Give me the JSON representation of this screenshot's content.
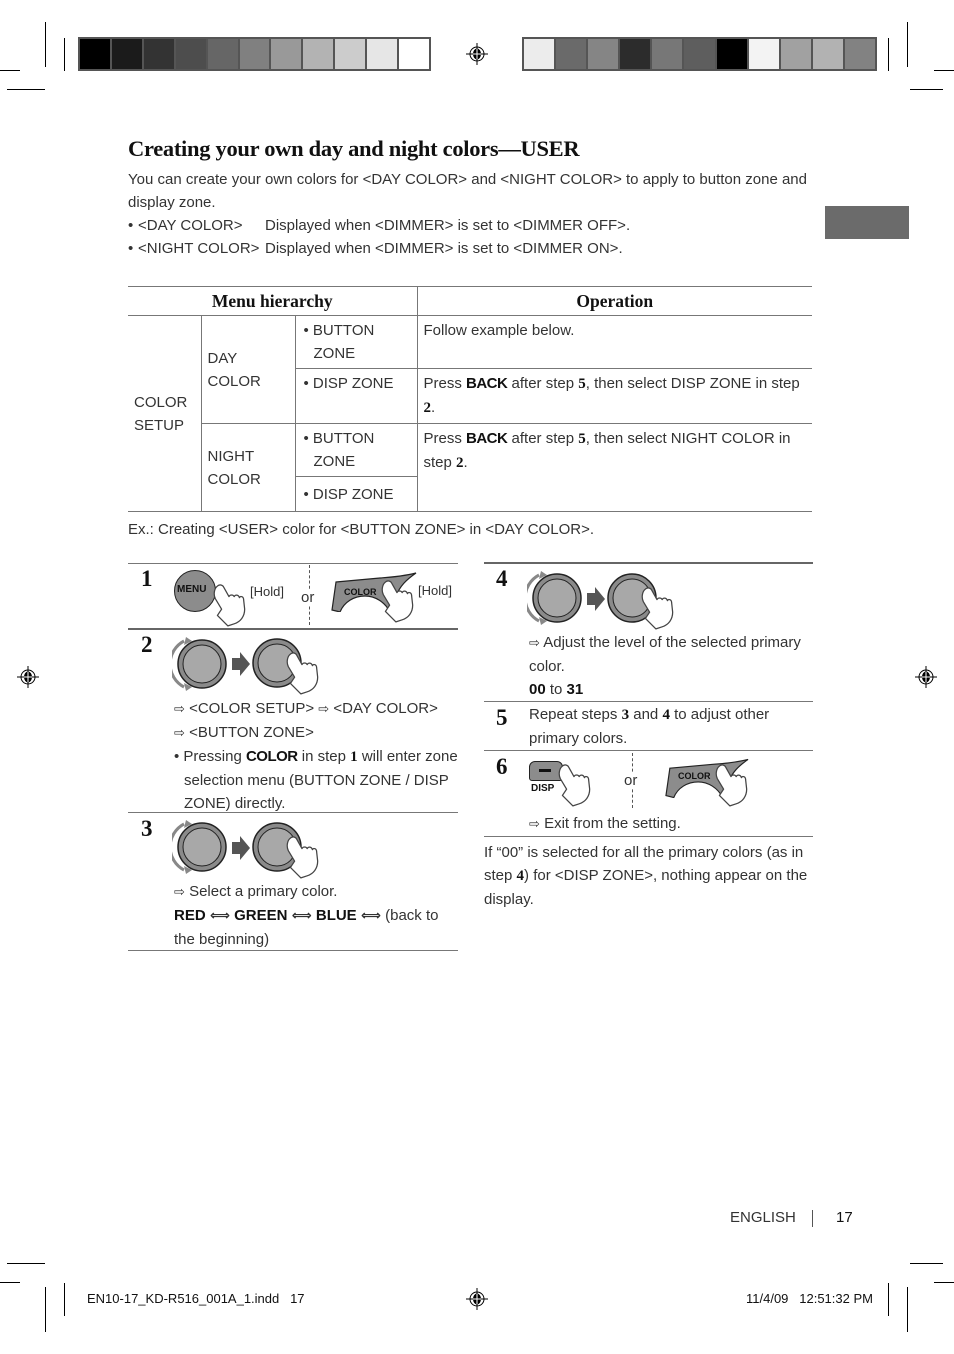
{
  "print_marks": {
    "colorbar_left": [
      "#000000",
      "#1b1b1b",
      "#333333",
      "#4d4d4d",
      "#666666",
      "#808080",
      "#999999",
      "#b3b3b3",
      "#cccccc",
      "#e6e6e6",
      "#ffffff"
    ],
    "colorbar_right": [
      "#ececec",
      "#6a6a6a",
      "#858585",
      "#2c2c2c",
      "#777777",
      "#5e5e5e",
      "#000000",
      "#f3f3f3",
      "#a1a1a1",
      "#b2b2b2",
      "#828282"
    ]
  },
  "section": {
    "title": "Creating your own day and night colors—USER",
    "intro": "You can create your own colors for <DAY COLOR> and <NIGHT COLOR> to apply to button zone and display zone.",
    "bullets": [
      {
        "key": "<DAY COLOR>",
        "text": "Displayed when <DIMMER> is set to <DIMMER OFF>."
      },
      {
        "key": "<NIGHT COLOR>",
        "text": "Displayed when <DIMMER> is set to <DIMMER ON>."
      }
    ]
  },
  "menu_table": {
    "headers": {
      "menu": "Menu hierarchy",
      "operation": "Operation"
    },
    "root": "COLOR SETUP",
    "groups": [
      {
        "name": "DAY COLOR",
        "items": [
          "BUTTON ZONE",
          "DISP ZONE"
        ]
      },
      {
        "name": "NIGHT COLOR",
        "items": [
          "BUTTON ZONE",
          "DISP ZONE"
        ]
      }
    ],
    "operations": {
      "day_button": "Follow example below.",
      "day_disp": {
        "pre": "Press ",
        "key": "BACK",
        "mid": " after step ",
        "step_a": "5",
        "mid2": ", then select DISP ZONE in step ",
        "step_b": "2",
        "post": "."
      },
      "night": {
        "pre": "Press ",
        "key": "BACK",
        "mid": " after step ",
        "step_a": "5",
        "mid2": ", then select NIGHT COLOR in step ",
        "step_b": "2",
        "post": "."
      }
    }
  },
  "example_caption": "Ex.: Creating <USER> color for <BUTTON ZONE> in <DAY COLOR>.",
  "steps": {
    "s1": {
      "num": "1",
      "menu_button": "MENU",
      "hold1": "[Hold]",
      "or": "or",
      "color_button": "COLOR",
      "hold2": "[Hold]"
    },
    "s2": {
      "num": "2",
      "arrow": "⇨",
      "line1a": "<COLOR SETUP>",
      "line1b": "<DAY COLOR>",
      "line2": "<BUTTON ZONE>",
      "note_pre": "Pressing ",
      "note_key": "COLOR",
      "note_mid": " in step ",
      "note_step": "1",
      "note_post": " will enter zone selection menu (BUTTON ZONE / DISP ZONE) directly."
    },
    "s3": {
      "num": "3",
      "arrow": "⇨",
      "text": "Select a primary color.",
      "seq": [
        "RED",
        "GREEN",
        "BLUE"
      ],
      "lr": "⟺",
      "tail": " (back to the beginning)"
    },
    "s4": {
      "num": "4",
      "arrow": "⇨",
      "text": "Adjust the level of the selected primary color.",
      "range_from": "00",
      "range_to": "31",
      "to": " to "
    },
    "s5": {
      "num": "5",
      "pre": "Repeat steps ",
      "a": "3",
      "mid": " and ",
      "b": "4",
      "post": " to adjust other primary colors."
    },
    "s6": {
      "num": "6",
      "disp_button": "DISP",
      "or": "or",
      "color_button": "COLOR",
      "arrow": "⇨",
      "text": "Exit from the setting."
    }
  },
  "note": {
    "pre": "If “00” is selected for all the primary colors (as in step ",
    "step": "4",
    "post": ") for <DISP ZONE>, nothing appear on the display."
  },
  "footer": {
    "language": "ENGLISH",
    "page": "17",
    "file": "EN10-17_KD-R516_001A_1.indd   17",
    "timestamp": "11/4/09   12:51:32 PM"
  }
}
